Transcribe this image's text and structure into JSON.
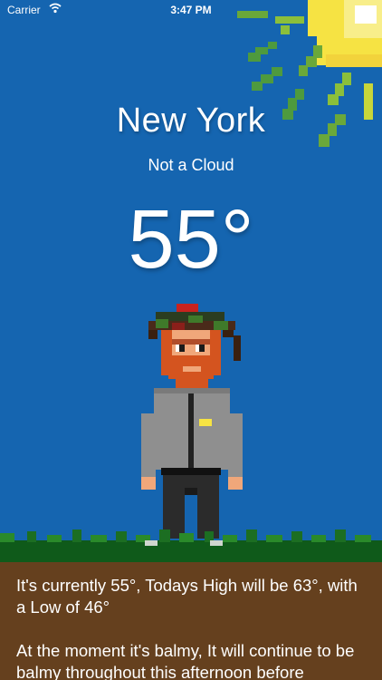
{
  "status_bar": {
    "carrier": "Carrier",
    "time": "3:47 PM",
    "wifi_icon": "wifi-icon"
  },
  "weather": {
    "city": "New York",
    "condition": "Not a Cloud",
    "temperature": "55°"
  },
  "summary": {
    "line_current": "It's currently 55°, Todays High will be 63°, with a Low of 46°",
    "line_forecast": "At the moment it's balmy, It will continue to be balmy throughout this afternoon before"
  },
  "colors": {
    "sky": "#1565b0",
    "ground_panel": "#65401e",
    "grass": "#0f5a1a",
    "sun": "#f6e343"
  }
}
